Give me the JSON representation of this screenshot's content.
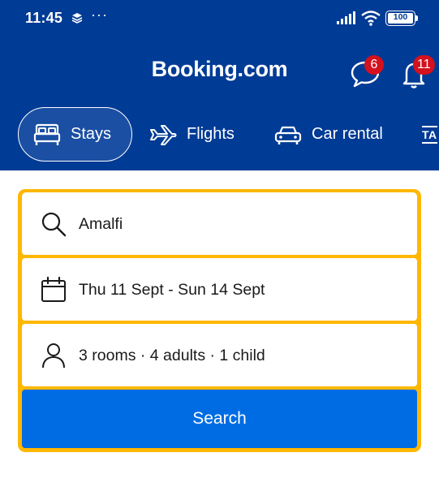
{
  "status_bar": {
    "time": "11:45",
    "more": "···",
    "battery": "100"
  },
  "header": {
    "brand": "Booking.com",
    "messages_badge": "6",
    "notifications_badge": "11",
    "background_color": "#003b95"
  },
  "tabs": [
    {
      "label": "Stays",
      "icon": "bed-icon",
      "selected": true
    },
    {
      "label": "Flights",
      "icon": "plane-icon",
      "selected": false
    },
    {
      "label": "Car rental",
      "icon": "car-icon",
      "selected": false
    },
    {
      "label": "TA",
      "icon": "taxi-icon",
      "selected": false
    }
  ],
  "search": {
    "destination": "Amalfi",
    "dates": "Thu 11 Sept - Sun 14 Sept",
    "guests": "3 rooms · 4 adults · 1 child",
    "button_label": "Search",
    "accent_color": "#ffb700",
    "button_color": "#006ce4"
  }
}
